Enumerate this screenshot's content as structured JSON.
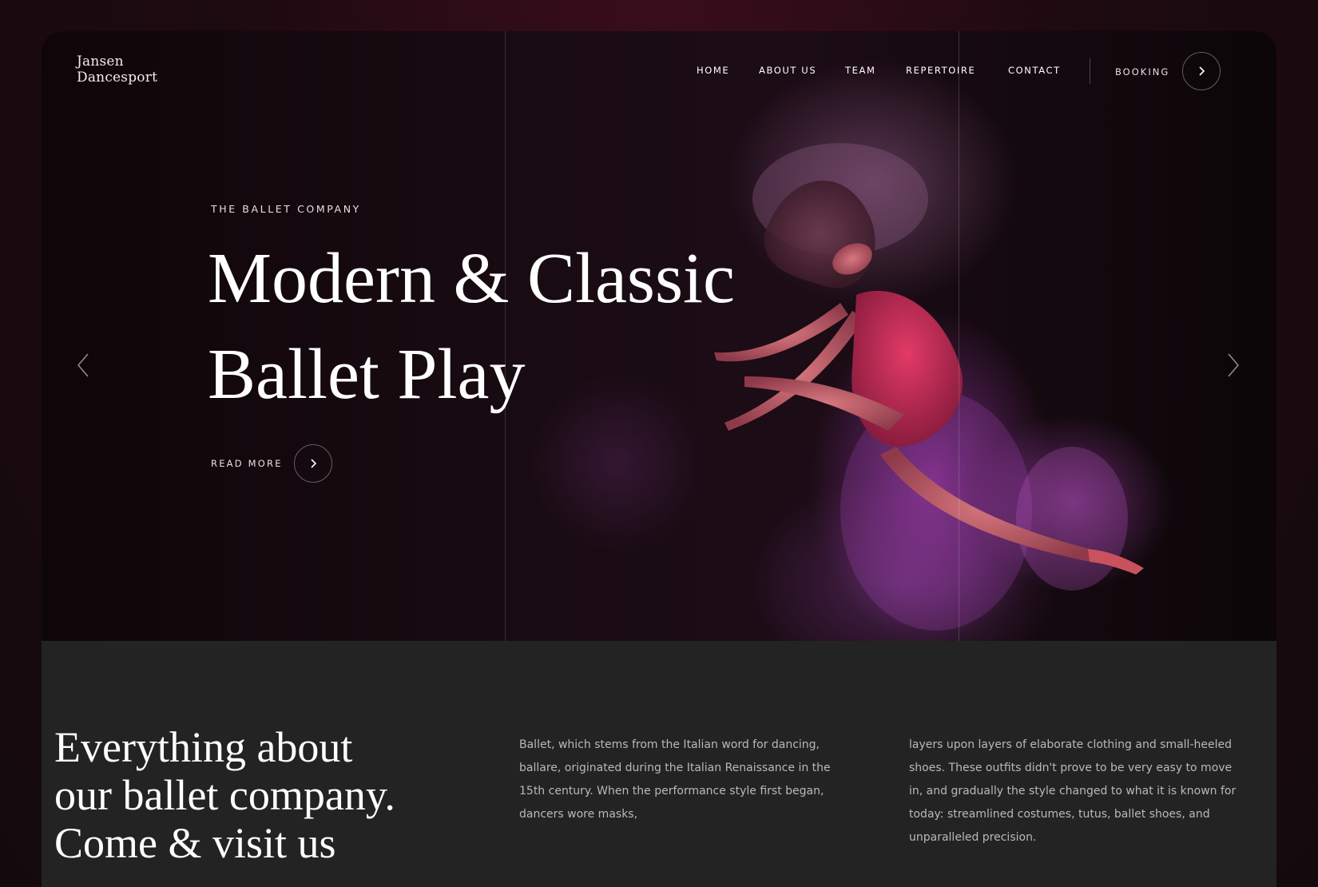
{
  "brand": {
    "line1": "Jansen",
    "line2": "Dancesport"
  },
  "nav": {
    "items": [
      "HOME",
      "ABOUT US",
      "TEAM",
      "REPERTOIRE",
      "CONTACT"
    ],
    "booking_label": "BOOKING"
  },
  "hero": {
    "eyebrow": "THE BALLET COMPANY",
    "headline_line1": "Modern & Classic",
    "headline_line2": "Ballet Play",
    "read_more": "READ MORE"
  },
  "about": {
    "title_line1": "Everything about",
    "title_line2": "our ballet company.",
    "title_line3": "Come & visit us",
    "paragraph1": "Ballet, which stems from the Italian word for dancing, ballare, originated during the Italian Renaissance in the 15th century. When the performance style first began, dancers wore masks,",
    "paragraph2": "layers upon layers of elaborate clothing and small-heeled shoes. These outfits didn't prove to be very easy to move in, and gradually the style changed to what it is known for today: streamlined costumes, tutus, ballet shoes, and unparalleled precision."
  },
  "icons": {
    "booking_arrow": "chevron-right-icon",
    "readmore_arrow": "chevron-right-icon",
    "prev_slide": "chevron-left-icon",
    "next_slide": "chevron-right-icon"
  },
  "colors": {
    "page_background": "#1d0a11",
    "hero_dark": "#150a10",
    "powder_accent": "#c04fd2",
    "section_background": "#232323",
    "body_text": "#b9b9b9"
  }
}
